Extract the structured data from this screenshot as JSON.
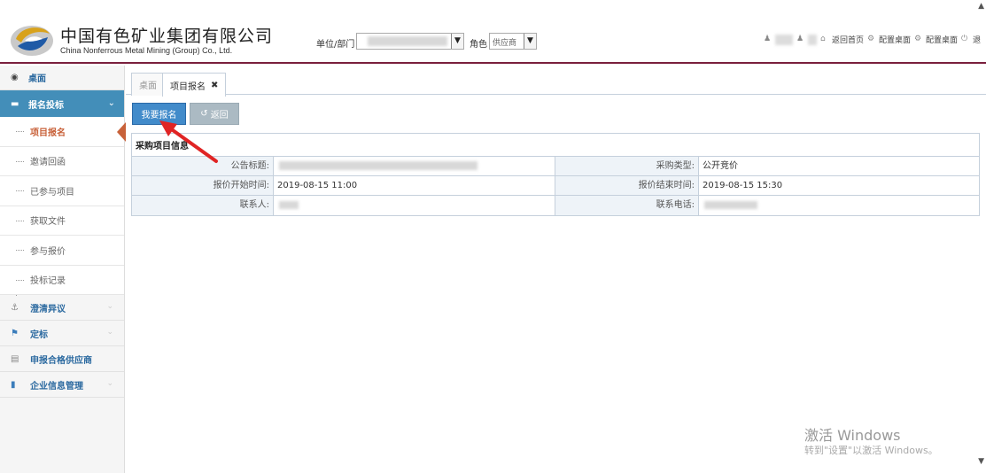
{
  "header": {
    "brand_cn": "中国有色矿业集团有限公司",
    "brand_en": "China Nonferrous Metal Mining (Group) Co., Ltd.",
    "unit_label": "单位/部门",
    "role_label": "角色",
    "role_value": "供应商",
    "links": {
      "home": "返回首页",
      "config1": "配置桌面",
      "config2": "配置桌面",
      "exit": "退"
    }
  },
  "sidebar": {
    "desktop": "桌面",
    "active_group": "报名投标",
    "sub_items": [
      "项目报名",
      "邀请回函",
      "已参与项目",
      "获取文件",
      "参与报价",
      "投标记录"
    ],
    "groups": [
      "澄清异议",
      "定标",
      "申报合格供应商",
      "企业信息管理"
    ]
  },
  "tabs": {
    "desktop": "桌面",
    "current": "项目报名"
  },
  "toolbar": {
    "signup": "我要报名",
    "back": "返回"
  },
  "panel": {
    "title": "采购项目信息",
    "announcement_label": "公告标题:",
    "purchase_type_label": "采购类型:",
    "purchase_type_value": "公开竞价",
    "start_label": "报价开始时间:",
    "start_value": "2019-08-15 11:00",
    "end_label": "报价结束时间:",
    "end_value": "2019-08-15 15:30",
    "contact_label": "联系人:",
    "phone_label": "联系电话:"
  },
  "watermark": {
    "line1": "激活 Windows",
    "line2": "转到\"设置\"以激活 Windows。"
  },
  "colors": {
    "accent": "#438eb9",
    "primary_button": "#428bca",
    "current_item": "#c86139",
    "header_rule": "#7a1f3d",
    "arrow": "#e02424"
  }
}
